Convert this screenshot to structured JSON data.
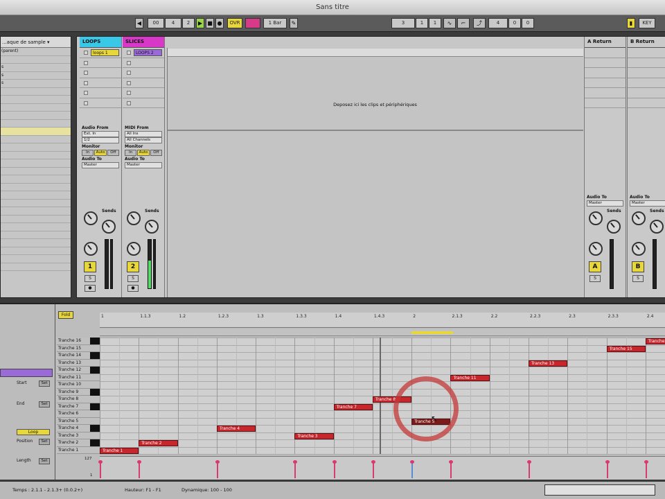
{
  "window": {
    "title": "Sans titre"
  },
  "transport": {
    "tempo_fields": [
      "00",
      "4",
      "2"
    ],
    "ovr_label": "OVR",
    "quantize_value": "1 Bar",
    "position": [
      "3",
      "1",
      "1"
    ],
    "loop_length": [
      "4",
      "0",
      "0"
    ],
    "key_label": "KEY"
  },
  "browser": {
    "header": "...aque de sample",
    "rows": [
      "(parent)",
      "",
      "s",
      "s",
      "s",
      "",
      "",
      "",
      "",
      "",
      "",
      "",
      "",
      "",
      "",
      "",
      "",
      "",
      "",
      "",
      "",
      "",
      "",
      "",
      "",
      "",
      "",
      ""
    ],
    "selected_row": 10
  },
  "session": {
    "drop_hint": "Deposez ici les clips et périphériques",
    "tracks": [
      {
        "name": "LOOPS",
        "color": "#3ac8e8",
        "clip": "loops 1",
        "clip_color": "#e8d73a",
        "input_label": "Audio From",
        "input_value": "Ext. In",
        "input_channel": "1/2",
        "monitor_label": "Monitor",
        "monitor_opts": [
          "In",
          "Auto",
          "Off"
        ],
        "output_label": "Audio To",
        "output_value": "Master",
        "sends_label": "Sends",
        "number": "1",
        "solo": "S"
      },
      {
        "name": "SLICES",
        "color": "#d838c8",
        "clip": "LOOPS 2",
        "clip_color": "#9a6ad8",
        "input_label": "MIDI From",
        "input_value": "All Ins",
        "input_channel": "All Channels",
        "monitor_label": "Monitor",
        "monitor_opts": [
          "In",
          "Auto",
          "Off"
        ],
        "output_label": "Audio To",
        "output_value": "Master",
        "sends_label": "Sends",
        "number": "2",
        "solo": "S"
      }
    ],
    "returns": [
      {
        "name": "A Return",
        "output_label": "Audio To",
        "output_value": "Master",
        "sends_label": "Sends",
        "letter": "A",
        "solo": "S"
      },
      {
        "name": "B Return",
        "output_label": "Audio To",
        "output_value": "Master",
        "sends_label": "Sends",
        "letter": "B",
        "solo": "S"
      }
    ]
  },
  "detail": {
    "fold_label": "Fold",
    "left_controls": {
      "start_label": "Start",
      "end_label": "End",
      "loop_label": "Loop",
      "position_label": "Position",
      "length_label": "Length",
      "set_label": "Set"
    },
    "ruler_ticks": [
      "1",
      "1.1.3",
      "1.2",
      "1.2.3",
      "1.3",
      "1.3.3",
      "1.4",
      "1.4.3",
      "2",
      "2.1.3",
      "2.2",
      "2.2.3",
      "2.3",
      "2.3.3",
      "2.4"
    ],
    "keys": [
      "Tranche 16",
      "Tranche 15",
      "Tranche 14",
      "Tranche 13",
      "Tranche 12",
      "Tranche 11",
      "Tranche 10",
      "Tranche 9",
      "Tranche 8",
      "Tranche 7",
      "Tranche 6",
      "Tranche 5",
      "Tranche 4",
      "Tranche 3",
      "Tranche 2",
      "Tranche 1"
    ],
    "notes": [
      {
        "label": "Tranche 1",
        "key_index": 15,
        "start": 0,
        "len": 1
      },
      {
        "label": "Tranche 2",
        "key_index": 14,
        "start": 1,
        "len": 1
      },
      {
        "label": "Tranche 4",
        "key_index": 12,
        "start": 3,
        "len": 1
      },
      {
        "label": "Tranche 3",
        "key_index": 13,
        "start": 5,
        "len": 1
      },
      {
        "label": "Tranche 7",
        "key_index": 9,
        "start": 6,
        "len": 1
      },
      {
        "label": "Tranche 8",
        "key_index": 8,
        "start": 7,
        "len": 1
      },
      {
        "label": "Tranche 5",
        "key_index": 11,
        "start": 8,
        "len": 1,
        "dragging": true
      },
      {
        "label": "Tranche 11",
        "key_index": 5,
        "start": 9,
        "len": 1
      },
      {
        "label": "Tranche 13",
        "key_index": 3,
        "start": 11,
        "len": 1
      },
      {
        "label": "Tranche 15",
        "key_index": 1,
        "start": 13,
        "len": 1
      },
      {
        "label": "Tranche 16",
        "key_index": 0,
        "start": 14,
        "len": 1
      }
    ],
    "velocity_max": "127",
    "velocity_min": "1"
  },
  "status": {
    "text": "Temps : 2.1.1 - 2.1.3+ (0.0.2+)",
    "pitch": "Hauteur: F1 - F1",
    "dynamics": "Dynamique: 100 - 100"
  },
  "colors": {
    "note": "#c8262d",
    "velocity": "#d83a6e",
    "highlight_ring": "#c43a3a"
  }
}
